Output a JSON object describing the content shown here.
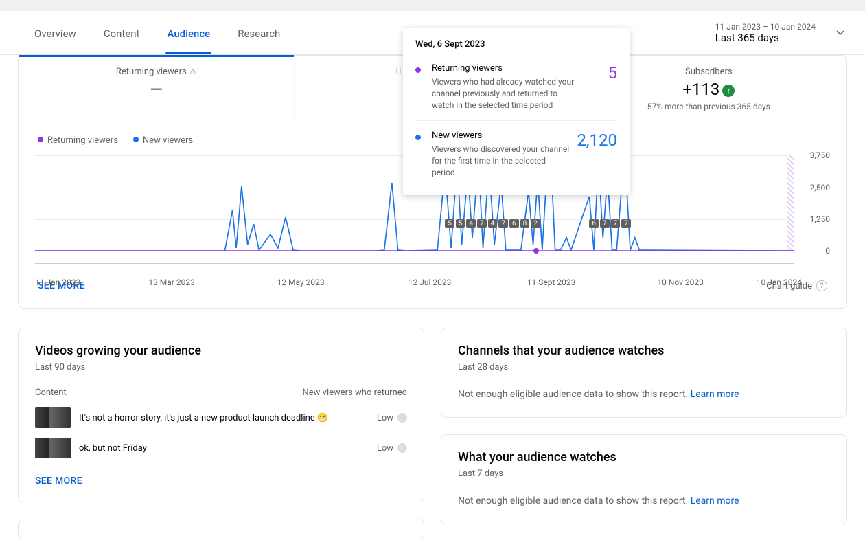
{
  "tabs": {
    "overview": "Overview",
    "content": "Content",
    "audience": "Audience",
    "research": "Research"
  },
  "date_range": {
    "range_text": "11 Jan 2023 – 10 Jan 2024",
    "label": "Last 365 days"
  },
  "metrics": {
    "returning": {
      "title": "Returning viewers",
      "value": "—"
    },
    "unique": {
      "title": "Unique viewers"
    },
    "subscribers": {
      "title": "Subscribers",
      "value": "+113",
      "sub": "57% more than previous 365 days"
    }
  },
  "legend": {
    "returning": "Returning viewers",
    "new": "New viewers"
  },
  "tooltip": {
    "date": "Wed, 6 Sept 2023",
    "returning": {
      "title": "Returning viewers",
      "desc": "Viewers who had already watched your channel previously and returned to watch in the selected time period",
      "value": "5"
    },
    "new": {
      "title": "New viewers",
      "desc": "Viewers who discovered your channel for the first time in the selected period",
      "value": "2,120"
    }
  },
  "chart": {
    "see_more": "SEE MORE",
    "guide": "Chart guide",
    "y_ticks": [
      "3,750",
      "2,500",
      "1,250",
      "0"
    ],
    "x_ticks": [
      "11 Jan 2023",
      "13 Mar 2023",
      "12 May 2023",
      "12 Jul 2023",
      "11 Sept 2023",
      "10 Nov 2023",
      "10 Jan 2024"
    ],
    "badges_left": [
      "5",
      "5",
      "4",
      "7",
      "4",
      "7",
      "6",
      "8",
      "2"
    ],
    "badges_right": [
      "6",
      "7",
      "7",
      "7"
    ]
  },
  "chart_data": {
    "type": "line",
    "x_range": [
      "2023-01-11",
      "2024-01-10"
    ],
    "ylim": [
      0,
      3750
    ],
    "series": [
      {
        "name": "Returning viewers",
        "color": "#9334e6",
        "note": "flat near zero across period; ~5 on 2023-09-06"
      },
      {
        "name": "New viewers",
        "color": "#1a73e8",
        "note": "sporadic spikes May–Oct 2023, peaks up to ~3000; 2,120 on 2023-09-06"
      }
    ],
    "highlight_date": "2023-09-06"
  },
  "videos_card": {
    "title": "Videos growing your audience",
    "sub": "Last 90 days",
    "col_content": "Content",
    "col_value": "New viewers who returned",
    "rows": [
      {
        "title": "It's not a horror story, it's just a new product launch deadline 😬",
        "value": "Low"
      },
      {
        "title": "ok, but not Friday",
        "value": "Low"
      }
    ],
    "see_more": "SEE MORE"
  },
  "channels_card": {
    "title": "Channels that your audience watches",
    "sub": "Last 28 days",
    "nodata": "Not enough eligible audience data to show this report.",
    "learn": "Learn more"
  },
  "watches_card": {
    "title": "What your audience watches",
    "sub": "Last 7 days",
    "nodata": "Not enough eligible audience data to show this report.",
    "learn": "Learn more"
  }
}
